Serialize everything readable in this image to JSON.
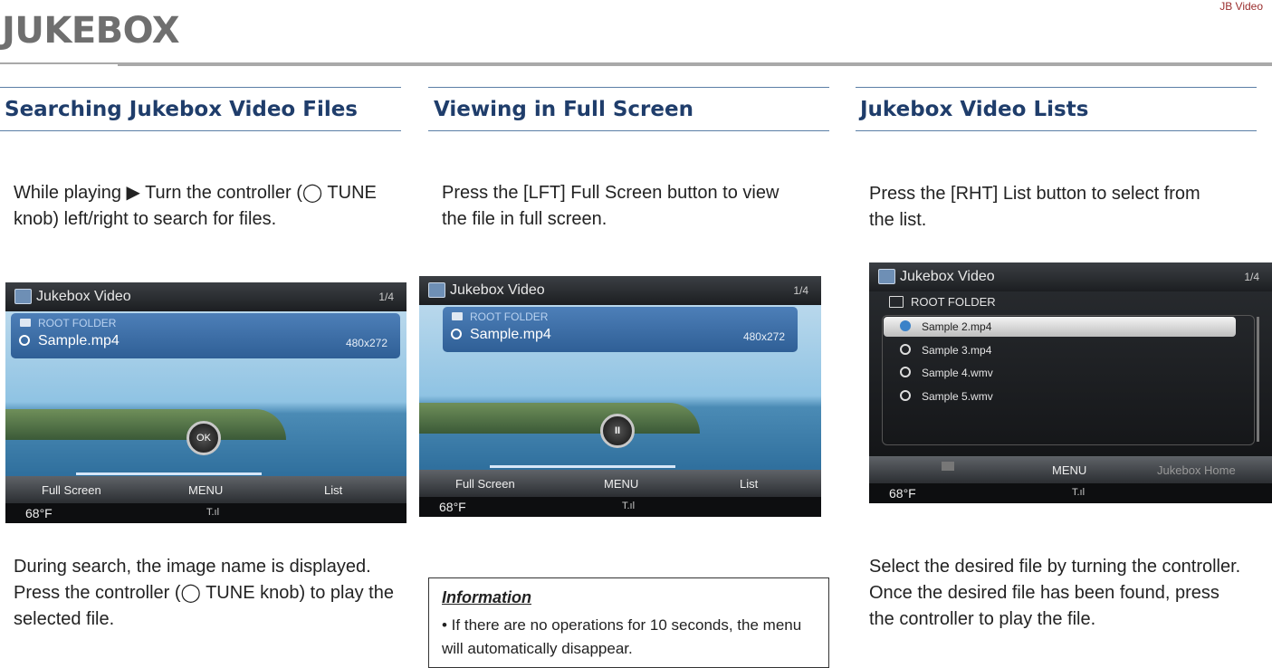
{
  "header": {
    "title": "JUKEBOX",
    "top_label": "JB Video"
  },
  "sections": [
    {
      "title": "Searching Jukebox Video Files",
      "text_top": "While playing ▶ Turn the controller (◯ TUNE knob) left/right to search for files.",
      "text_bottom": "During search, the image name is displayed. Press the controller (◯ TUNE knob) to play the selected file.",
      "screen": {
        "app_title": "Jukebox Video",
        "page": "1/4",
        "folder": "ROOT FOLDER",
        "file": "Sample.mp4",
        "resolution": "480x272",
        "center_button": "OK",
        "menu_left": "Full Screen",
        "menu_center": "MENU",
        "menu_right": "List",
        "temperature": "68°F",
        "signal": "T.ıl"
      }
    },
    {
      "title": "Viewing in Full Screen",
      "text_top": "Press the [LFT] Full Screen button to view the file in full screen.",
      "screen": {
        "app_title": "Jukebox Video",
        "page": "1/4",
        "folder": "ROOT FOLDER",
        "file": "Sample.mp4",
        "resolution": "480x272",
        "center_button": "II",
        "menu_left": "Full Screen",
        "menu_center": "MENU",
        "menu_right": "List",
        "temperature": "68°F",
        "signal": "T.ıl"
      },
      "info": {
        "heading": "Information",
        "text": "• If there are no operations for 10 seconds, the menu will automatically disappear."
      }
    },
    {
      "title": "Jukebox Video Lists",
      "text_top": "Press the [RHT] List button to select from the list.",
      "text_bottom": "Select the desired file by turning the controller. Once the desired file has been found, press the controller to play the file.",
      "screen": {
        "app_title": "Jukebox Video",
        "page": "1/4",
        "folder": "ROOT FOLDER",
        "items": [
          "Sample 2.mp4",
          "Sample 3.mp4",
          "Sample 4.wmv",
          "Sample 5.wmv"
        ],
        "menu_center": "MENU",
        "menu_right": "Jukebox Home",
        "temperature": "68°F",
        "signal": "T.ıl"
      }
    }
  ],
  "colors": {
    "title_gray": "#6f6f6f",
    "section_blue": "#1f3d6b",
    "rule_blue": "#5b7fa6"
  }
}
